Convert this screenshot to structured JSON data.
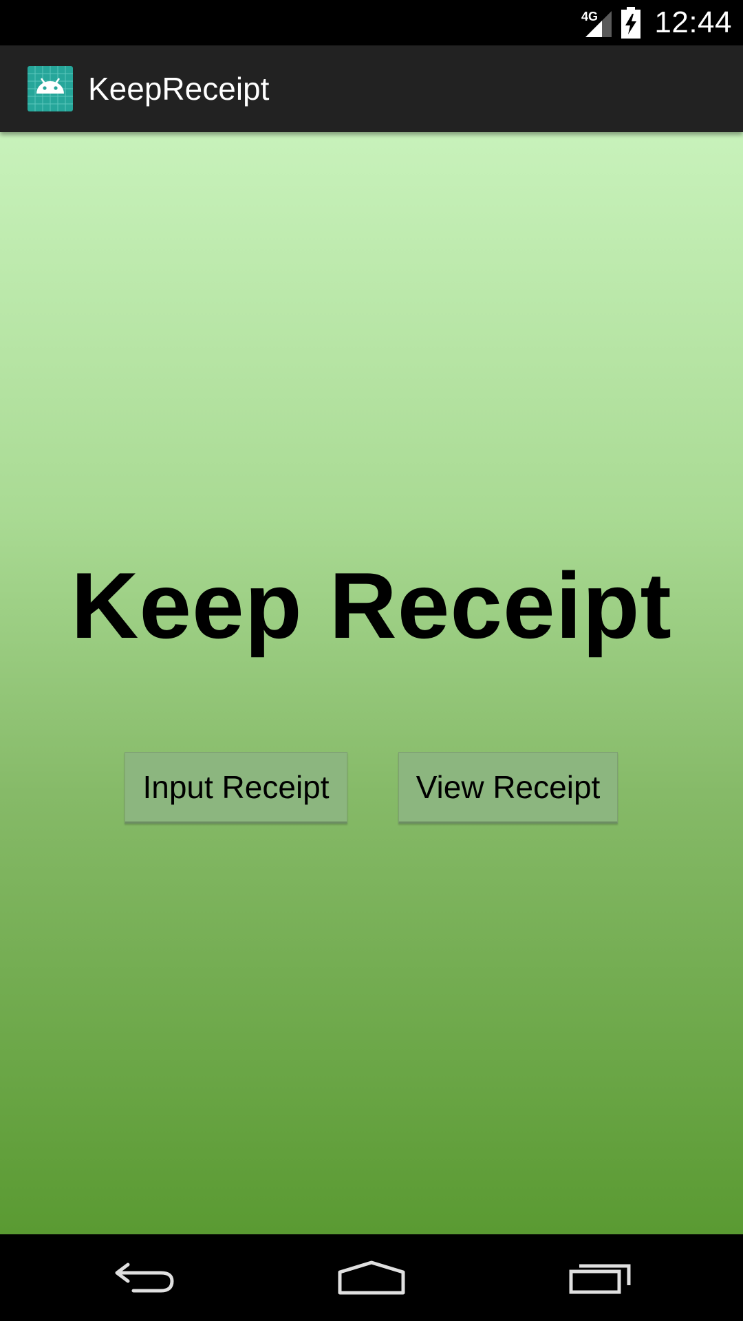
{
  "status_bar": {
    "network_label": "4G",
    "time": "12:44",
    "icons": [
      "signal-icon",
      "battery-charging-icon"
    ]
  },
  "app_bar": {
    "title": "KeepReceipt",
    "icon": "android-app-icon",
    "icon_color": "#26a69a"
  },
  "main": {
    "headline": "Keep Receipt",
    "buttons": {
      "input_label": "Input Receipt",
      "view_label": "View Receipt"
    },
    "background_colors": [
      "#c8f2bb",
      "#5a9a32"
    ]
  },
  "nav_bar": {
    "icons": [
      "back-icon",
      "home-icon",
      "recents-icon"
    ]
  }
}
